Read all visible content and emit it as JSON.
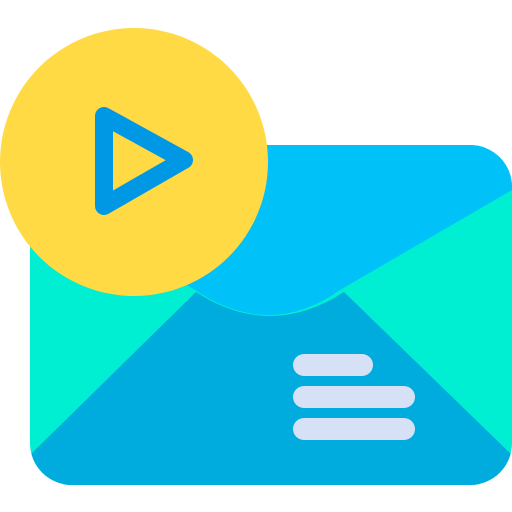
{
  "icon": {
    "name": "video-mail-icon",
    "colors": {
      "envelope_side": "#00EED1",
      "envelope_top": "#00C1F8",
      "envelope_front": "#00ABDE",
      "text_lines": "#D6E1F5",
      "badge": "#FFDA44",
      "play": "#0098E4"
    }
  }
}
